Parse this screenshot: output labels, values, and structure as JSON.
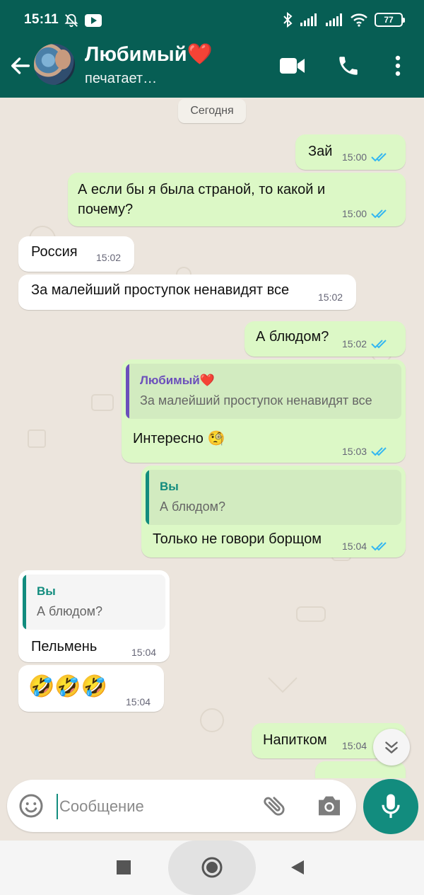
{
  "status_bar": {
    "time": "15:11",
    "battery": "77"
  },
  "contact": {
    "name": "Любимый❤️",
    "status": "печатает…"
  },
  "date_separator": "Сегодня",
  "messages": [
    {
      "text": "Зай",
      "time": "15:00"
    },
    {
      "text_line1": "А если бы я была страной, то какой и",
      "text_line2": "почему?",
      "time": "15:00"
    },
    {
      "text": "Россия",
      "time": "15:02"
    },
    {
      "text": "За малейший проступок ненавидят все",
      "time": "15:02"
    },
    {
      "text": "А блюдом?",
      "time": "15:02"
    },
    {
      "quote_author": "Любимый❤️",
      "quote_text": "За малейший проступок ненавидят все",
      "text": "Интересно 🧐",
      "time": "15:03"
    },
    {
      "quote_author": "Вы",
      "quote_text": "А блюдом?",
      "text": "Только не говори борщом",
      "time": "15:04"
    },
    {
      "quote_author": "Вы",
      "quote_text": "А блюдом?",
      "text": "Пельмень",
      "time": "15:04"
    },
    {
      "text": "🤣🤣🤣",
      "time": "15:04"
    },
    {
      "text": "Напитком",
      "time": "15:04"
    }
  ],
  "input": {
    "placeholder": "Сообщение",
    "value": ""
  },
  "colors": {
    "header": "#075e54",
    "accent": "#128c7e",
    "outgoing_bubble": "#dcf8c6",
    "read_ticks": "#34b7f1",
    "quote_me": "#128c7e",
    "quote_contact": "#6b4fbb"
  },
  "icons": [
    "back-arrow-icon",
    "video-call-icon",
    "phone-icon",
    "more-vert-icon",
    "emoji-icon",
    "attach-icon",
    "camera-icon",
    "mic-icon",
    "scroll-down-icon",
    "read-receipt-icon"
  ]
}
